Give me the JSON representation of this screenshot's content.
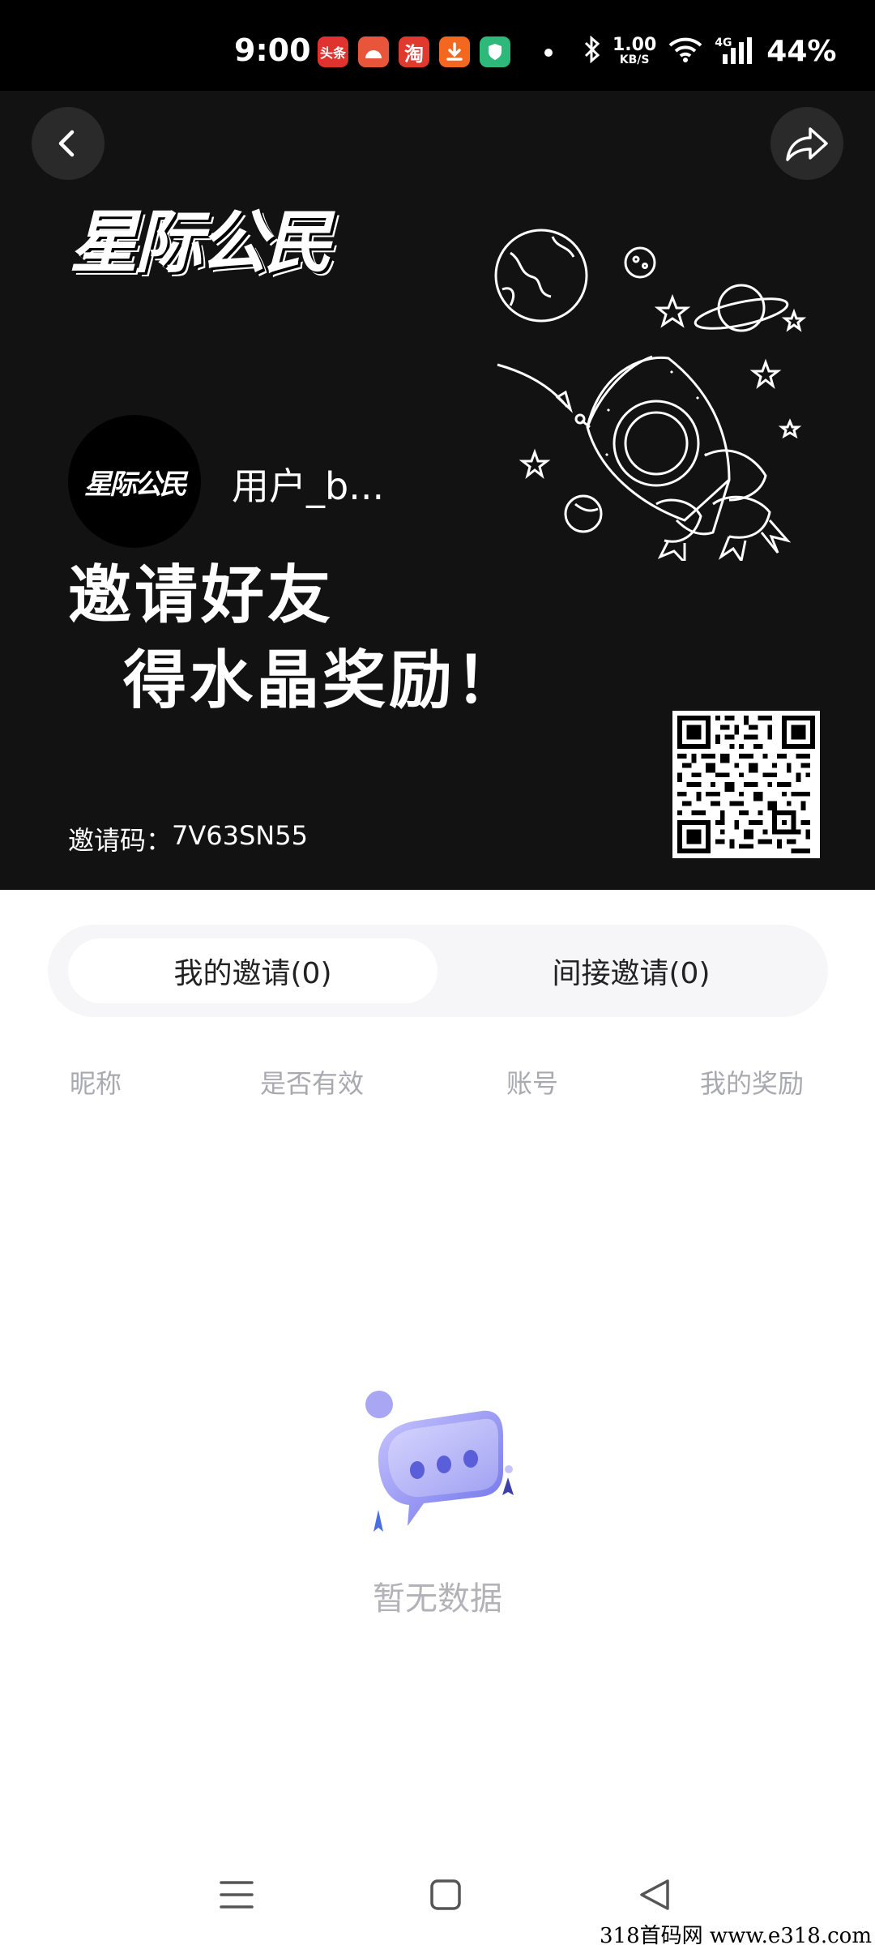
{
  "status_bar": {
    "time": "9:00",
    "notifications": [
      {
        "icon": "toutiao-icon",
        "label": "头条",
        "color": "#e0322f"
      },
      {
        "icon": "weather-icon",
        "label": "",
        "color": "#e8553a"
      },
      {
        "icon": "taobao-icon",
        "label": "淘",
        "color": "#e03a2f"
      },
      {
        "icon": "download-icon",
        "label": "",
        "color": "#f3671e"
      },
      {
        "icon": "security-icon",
        "label": "",
        "color": "#2eb87a"
      }
    ],
    "net_speed_value": "1.00",
    "net_speed_unit": "KB/S",
    "network_type": "4G",
    "battery": "44%"
  },
  "hero": {
    "brand_logo": "星际公民",
    "username": "用户_b...",
    "headline_line1": "邀请好友",
    "headline_line2": "得水晶奖励！",
    "invite_code_label": "邀请码：",
    "invite_code_value": "7V63SN55"
  },
  "tabs": [
    {
      "label": "我的邀请(0)",
      "active": true
    },
    {
      "label": "间接邀请(0)",
      "active": false
    }
  ],
  "table": {
    "columns": [
      "昵称",
      "是否有效",
      "账号",
      "我的奖励"
    ]
  },
  "empty_state": {
    "text": "暂无数据"
  },
  "watermark": "318首码网  www.e318.com",
  "colors": {
    "hero_bg": "#121212",
    "tab_track": "#f6f6f8",
    "muted_text": "#a9a9b2",
    "illustration_purple": "#7b7ff2"
  }
}
